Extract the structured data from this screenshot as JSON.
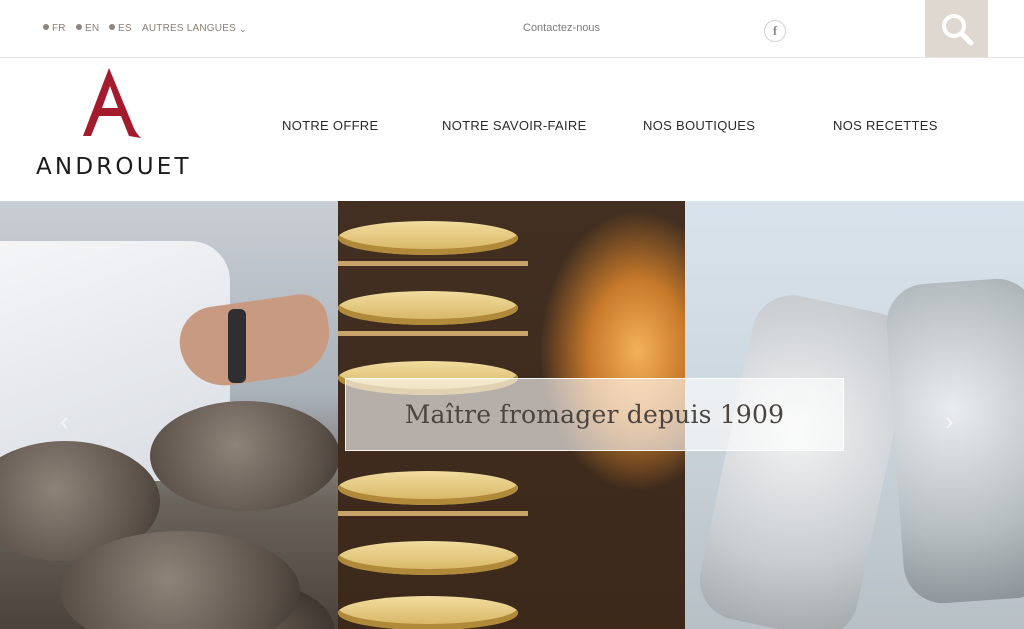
{
  "topbar": {
    "languages": [
      "FR",
      "EN",
      "ES"
    ],
    "other_languages": "AUTRES LANGUES",
    "contact": "Contactez-nous",
    "facebook_glyph": "f"
  },
  "brand": {
    "logo_letter": "A",
    "name": "ANDROUET",
    "accent_color": "#a31b2c"
  },
  "nav": [
    "NOTRE OFFRE",
    "NOTRE SAVOIR-FAIRE",
    "NOS BOUTIQUES",
    "NOS RECETTES"
  ],
  "hero": {
    "caption": "Maître fromager depuis 1909",
    "prev_arrow": "‹",
    "next_arrow": "›"
  },
  "icons": {
    "search": "search-icon",
    "facebook": "facebook-icon",
    "chevron": "chevron-down-icon"
  }
}
